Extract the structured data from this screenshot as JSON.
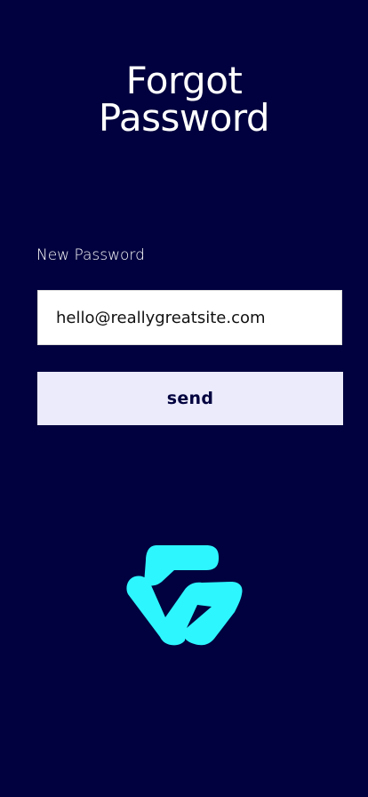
{
  "page": {
    "background": "#01013f",
    "title_line1": "Forgot",
    "title_line2": "Password"
  },
  "form": {
    "label": "New Password",
    "input_value": "hello@reallygreatsite.com",
    "send_label": "send"
  },
  "logo": {
    "icon": "ws-logo-icon",
    "color": "#2ef6ff"
  }
}
